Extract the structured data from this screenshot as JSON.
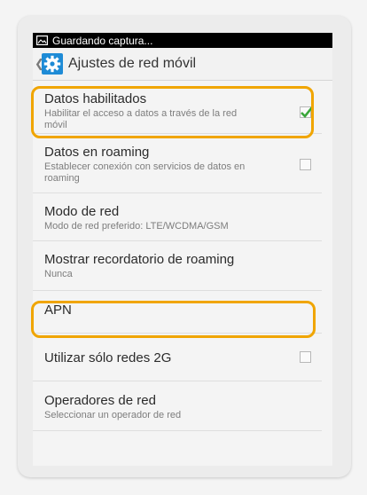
{
  "status_bar": {
    "text": "Guardando captura...",
    "icon": "screenshot-icon"
  },
  "action_bar": {
    "title": "Ajustes de red móvil",
    "back_icon": "chevron-left-icon",
    "app_icon": "settings-gear-icon"
  },
  "settings": [
    {
      "id": "datos-habilitados",
      "title": "Datos habilitados",
      "subtitle": "Habilitar el acceso a datos a través de la red móvil",
      "checkbox": true,
      "checked": true
    },
    {
      "id": "datos-en-roaming",
      "title": "Datos en roaming",
      "subtitle": "Establecer conexión con servicios de datos en roaming",
      "checkbox": true,
      "checked": false
    },
    {
      "id": "modo-de-red",
      "title": "Modo de red",
      "subtitle": "Modo de red preferido: LTE/WCDMA/GSM",
      "checkbox": false
    },
    {
      "id": "mostrar-recordatorio-roaming",
      "title": "Mostrar recordatorio de roaming",
      "subtitle": "Nunca",
      "checkbox": false
    },
    {
      "id": "apn",
      "title": "APN",
      "subtitle": "",
      "checkbox": false
    },
    {
      "id": "utilizar-solo-2g",
      "title": "Utilizar sólo redes 2G",
      "subtitle": "",
      "checkbox": true,
      "checked": false
    },
    {
      "id": "operadores-de-red",
      "title": "Operadores de red",
      "subtitle": "Seleccionar un operador de red",
      "checkbox": false
    }
  ],
  "colors": {
    "highlight": "#f0a500",
    "check": "#3aa63a",
    "action_icon": "#1e8bd6"
  }
}
